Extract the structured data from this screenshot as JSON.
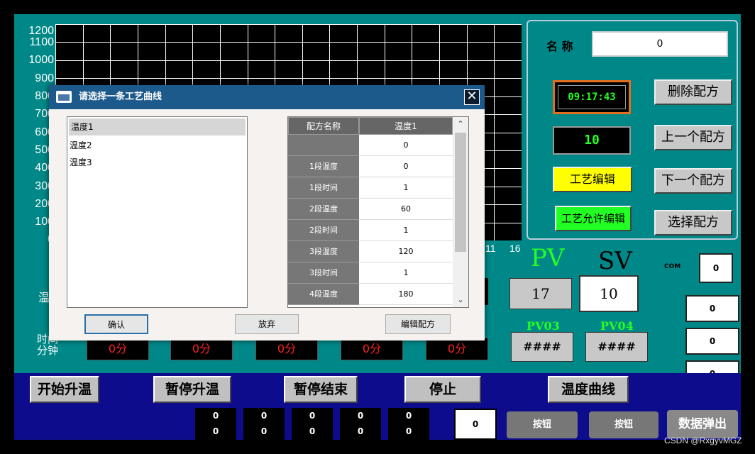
{
  "chart": {
    "y_ticks": [
      "1200",
      "1100",
      "1000",
      "900",
      "800",
      "700",
      "600",
      "500",
      "400",
      "300",
      "200",
      "100",
      "0"
    ],
    "x_ticks_visible": [
      "11",
      "16"
    ]
  },
  "recipe_panel": {
    "name_label": "名  称",
    "name_value": "0",
    "time": "09:17:43",
    "counter": "10",
    "process_edit_button": "工艺编辑",
    "allow_edit_button": "工艺允许编辑",
    "delete_recipe_button": "删除配方",
    "prev_recipe_button": "上一个配方",
    "next_recipe_button": "下一个配方",
    "select_recipe_button": "选择配方"
  },
  "readouts": {
    "pv_label": "PV",
    "sv_label": "SV",
    "pv_value": "17",
    "sv_value": "10",
    "pv03_label": "PV03",
    "pv04_label": "PV04",
    "pv03_value": "####",
    "pv04_value": "####",
    "com_label": "COM",
    "com_value": "0",
    "side_values": [
      "0",
      "0",
      "0"
    ]
  },
  "stage_times": {
    "row_label_line1": "时间",
    "row_label_line2": "分钟",
    "temp_label_partial": "温",
    "values": [
      "0分",
      "0分",
      "0分",
      "0分",
      "0分"
    ]
  },
  "bottom_bar": {
    "buttons": [
      "开始升温",
      "暂停升温",
      "暂停结束",
      "停止",
      "温度曲线"
    ],
    "mini_values": [
      [
        "0",
        "0"
      ],
      [
        "0",
        "0"
      ],
      [
        "0",
        "0"
      ],
      [
        "0",
        "0"
      ],
      [
        "0",
        "0"
      ]
    ],
    "value_box": "0",
    "button_a": "按钮",
    "button_b": "按钮",
    "data_popup_button": "数据弹出"
  },
  "dialog": {
    "title": "请选择一条工艺曲线",
    "curves": [
      "温度1",
      "温度2",
      "温度3"
    ],
    "selected_curve": "温度1",
    "table_headers": [
      "配方名称",
      "温度1"
    ],
    "table_rows": [
      [
        "",
        "0"
      ],
      [
        "1段温度",
        "0"
      ],
      [
        "1段时间",
        "1"
      ],
      [
        "2段温度",
        "60"
      ],
      [
        "2段时间",
        "1"
      ],
      [
        "3段温度",
        "120"
      ],
      [
        "3段时间",
        "1"
      ],
      [
        "4段温度",
        "180"
      ]
    ],
    "confirm_button": "确认",
    "cancel_button": "放弃",
    "edit_recipe_button": "编辑配方",
    "close_glyph": "✕"
  },
  "watermark": "CSDN @RxgyvMGZ",
  "colors": {
    "screen_bg": "#008888",
    "bottom_bar_bg": "#0c0c8c",
    "dialog_title_bg": "#1d5a8c",
    "highlight_yellow": "#ffff00",
    "highlight_green": "#22ff22",
    "stage_text_red": "#ff2222"
  }
}
